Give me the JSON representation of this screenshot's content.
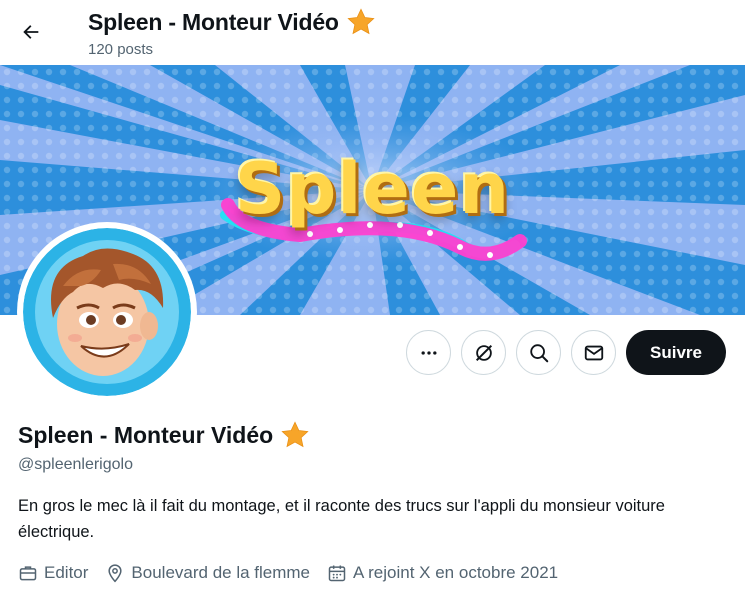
{
  "header": {
    "title": "Spleen - Monteur Vidéo",
    "posts_count": "120 posts"
  },
  "banner": {
    "title": "Spleen",
    "colors": {
      "sky": "#8fb3f2",
      "rays": "#2d8fdc",
      "text": "#ffd54a",
      "stars": "#ff3fd0"
    }
  },
  "profile": {
    "name": "Spleen - Monteur Vidéo",
    "handle": "@spleenlerigolo",
    "bio": "En gros le mec là il fait du montage, et il raconte des trucs sur l'appli du monsieur voiture électrique.",
    "meta": {
      "profession": "Editor",
      "location": "Boulevard de la flemme",
      "joined": "A rejoint X en octobre 2021"
    }
  },
  "actions": {
    "follow_label": "Suivre",
    "icons": [
      "more-icon",
      "grok-icon",
      "search-icon",
      "mail-icon"
    ]
  },
  "colors": {
    "accent": "#0f1419",
    "muted": "#536471",
    "border": "#cfd9de",
    "star": "#f7a529"
  }
}
